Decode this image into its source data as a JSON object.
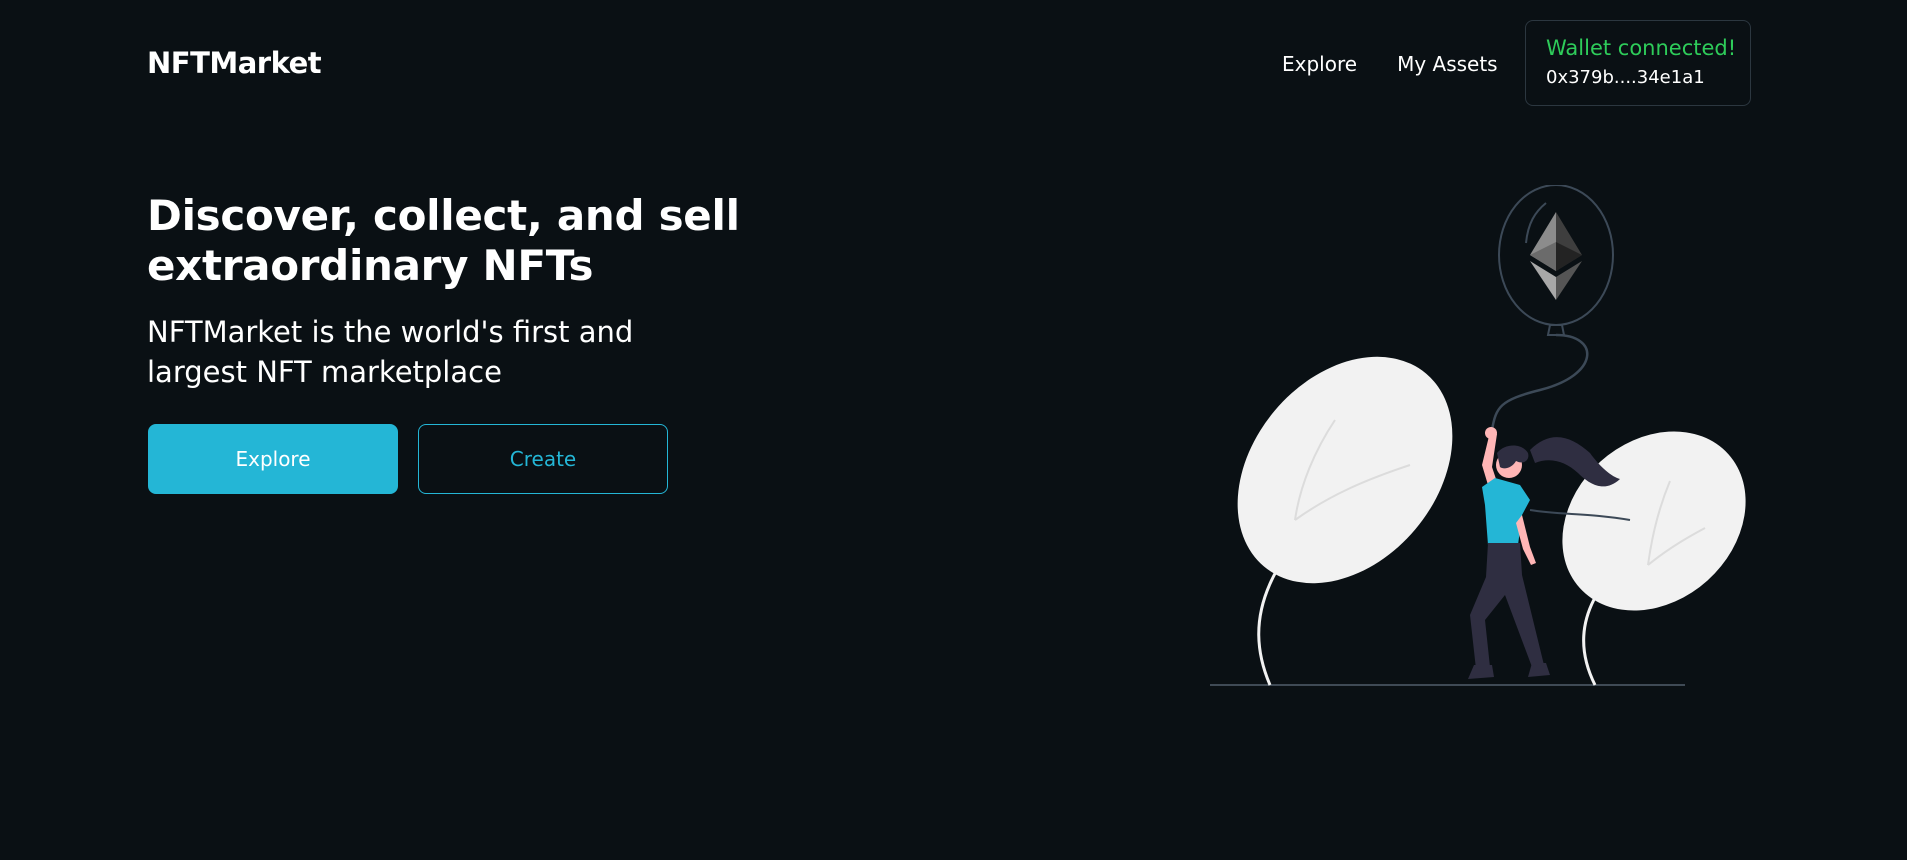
{
  "brand": {
    "name": "NFTMarket"
  },
  "nav": {
    "items": [
      {
        "label": "Explore"
      },
      {
        "label": "My Assets"
      }
    ]
  },
  "wallet": {
    "status": "Wallet connected!",
    "address": "0x379b....34e1a1"
  },
  "hero": {
    "title": "Discover, collect, and sell extraordinary NFTs",
    "subtitle": "NFTMarket is the world's first and largest NFT marketplace",
    "primary_button": "Explore",
    "secondary_button": "Create"
  },
  "illustration": {
    "icon": "ethereum-balloon-illustration"
  },
  "colors": {
    "background": "#0a1014",
    "accent": "#24b6d6",
    "success": "#2ecc5a"
  }
}
